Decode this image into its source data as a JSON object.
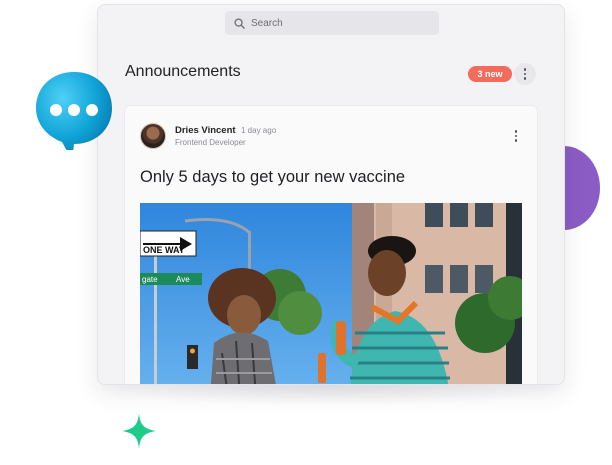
{
  "search": {
    "placeholder": "Search"
  },
  "header": {
    "title": "Announcements",
    "badge": "3 new"
  },
  "post": {
    "author": "Dries Vincent",
    "time": "1 day ago",
    "role": "Frontend Developer",
    "title": "Only 5 days to get your new vaccine"
  },
  "photo": {
    "sign_one_way": "ONE WAY",
    "street_sign_left": "gate",
    "street_sign_right": "Ave"
  },
  "colors": {
    "accent_badge": "#f26b5b",
    "chat_bubble": "#0fa3d6",
    "sparkle": "#1ecb8a",
    "blob": "#8b5cc4"
  },
  "icons": [
    "search-icon",
    "kebab-menu-icon",
    "chat-bubble-icon",
    "sparkle-icon"
  ]
}
